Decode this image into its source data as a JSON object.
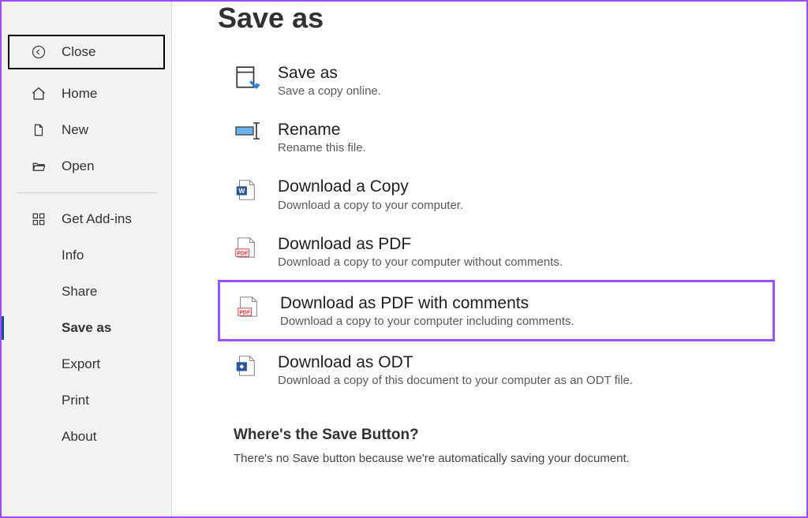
{
  "sidebar": {
    "close": {
      "label": "Close"
    },
    "home": {
      "label": "Home"
    },
    "new": {
      "label": "New"
    },
    "open": {
      "label": "Open"
    },
    "addins": {
      "label": "Get Add-ins"
    },
    "info": {
      "label": "Info"
    },
    "share": {
      "label": "Share"
    },
    "saveas": {
      "label": "Save as"
    },
    "export": {
      "label": "Export"
    },
    "print": {
      "label": "Print"
    },
    "about": {
      "label": "About"
    }
  },
  "page_title": "Save as",
  "options": {
    "saveas": {
      "title": "Save as",
      "desc": "Save a copy online."
    },
    "rename": {
      "title": "Rename",
      "desc": "Rename this file."
    },
    "copy": {
      "title": "Download a Copy",
      "desc": "Download a copy to your computer."
    },
    "pdf": {
      "title": "Download as PDF",
      "desc": "Download a copy to your computer without comments."
    },
    "pdfc": {
      "title": "Download as PDF with comments",
      "desc": "Download a copy to your computer including comments."
    },
    "odt": {
      "title": "Download as ODT",
      "desc": "Download a copy of this document to your computer as an ODT file."
    }
  },
  "footer": {
    "title": "Where's the Save Button?",
    "desc": "There's no Save button because we're automatically saving your document."
  }
}
